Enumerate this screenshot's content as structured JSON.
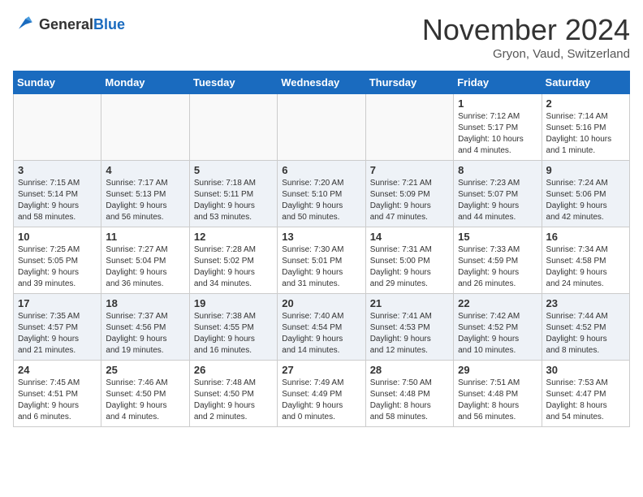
{
  "logo": {
    "general": "General",
    "blue": "Blue"
  },
  "header": {
    "month": "November 2024",
    "location": "Gryon, Vaud, Switzerland"
  },
  "weekdays": [
    "Sunday",
    "Monday",
    "Tuesday",
    "Wednesday",
    "Thursday",
    "Friday",
    "Saturday"
  ],
  "weeks": [
    [
      {
        "day": "",
        "info": ""
      },
      {
        "day": "",
        "info": ""
      },
      {
        "day": "",
        "info": ""
      },
      {
        "day": "",
        "info": ""
      },
      {
        "day": "",
        "info": ""
      },
      {
        "day": "1",
        "info": "Sunrise: 7:12 AM\nSunset: 5:17 PM\nDaylight: 10 hours\nand 4 minutes."
      },
      {
        "day": "2",
        "info": "Sunrise: 7:14 AM\nSunset: 5:16 PM\nDaylight: 10 hours\nand 1 minute."
      }
    ],
    [
      {
        "day": "3",
        "info": "Sunrise: 7:15 AM\nSunset: 5:14 PM\nDaylight: 9 hours\nand 58 minutes."
      },
      {
        "day": "4",
        "info": "Sunrise: 7:17 AM\nSunset: 5:13 PM\nDaylight: 9 hours\nand 56 minutes."
      },
      {
        "day": "5",
        "info": "Sunrise: 7:18 AM\nSunset: 5:11 PM\nDaylight: 9 hours\nand 53 minutes."
      },
      {
        "day": "6",
        "info": "Sunrise: 7:20 AM\nSunset: 5:10 PM\nDaylight: 9 hours\nand 50 minutes."
      },
      {
        "day": "7",
        "info": "Sunrise: 7:21 AM\nSunset: 5:09 PM\nDaylight: 9 hours\nand 47 minutes."
      },
      {
        "day": "8",
        "info": "Sunrise: 7:23 AM\nSunset: 5:07 PM\nDaylight: 9 hours\nand 44 minutes."
      },
      {
        "day": "9",
        "info": "Sunrise: 7:24 AM\nSunset: 5:06 PM\nDaylight: 9 hours\nand 42 minutes."
      }
    ],
    [
      {
        "day": "10",
        "info": "Sunrise: 7:25 AM\nSunset: 5:05 PM\nDaylight: 9 hours\nand 39 minutes."
      },
      {
        "day": "11",
        "info": "Sunrise: 7:27 AM\nSunset: 5:04 PM\nDaylight: 9 hours\nand 36 minutes."
      },
      {
        "day": "12",
        "info": "Sunrise: 7:28 AM\nSunset: 5:02 PM\nDaylight: 9 hours\nand 34 minutes."
      },
      {
        "day": "13",
        "info": "Sunrise: 7:30 AM\nSunset: 5:01 PM\nDaylight: 9 hours\nand 31 minutes."
      },
      {
        "day": "14",
        "info": "Sunrise: 7:31 AM\nSunset: 5:00 PM\nDaylight: 9 hours\nand 29 minutes."
      },
      {
        "day": "15",
        "info": "Sunrise: 7:33 AM\nSunset: 4:59 PM\nDaylight: 9 hours\nand 26 minutes."
      },
      {
        "day": "16",
        "info": "Sunrise: 7:34 AM\nSunset: 4:58 PM\nDaylight: 9 hours\nand 24 minutes."
      }
    ],
    [
      {
        "day": "17",
        "info": "Sunrise: 7:35 AM\nSunset: 4:57 PM\nDaylight: 9 hours\nand 21 minutes."
      },
      {
        "day": "18",
        "info": "Sunrise: 7:37 AM\nSunset: 4:56 PM\nDaylight: 9 hours\nand 19 minutes."
      },
      {
        "day": "19",
        "info": "Sunrise: 7:38 AM\nSunset: 4:55 PM\nDaylight: 9 hours\nand 16 minutes."
      },
      {
        "day": "20",
        "info": "Sunrise: 7:40 AM\nSunset: 4:54 PM\nDaylight: 9 hours\nand 14 minutes."
      },
      {
        "day": "21",
        "info": "Sunrise: 7:41 AM\nSunset: 4:53 PM\nDaylight: 9 hours\nand 12 minutes."
      },
      {
        "day": "22",
        "info": "Sunrise: 7:42 AM\nSunset: 4:52 PM\nDaylight: 9 hours\nand 10 minutes."
      },
      {
        "day": "23",
        "info": "Sunrise: 7:44 AM\nSunset: 4:52 PM\nDaylight: 9 hours\nand 8 minutes."
      }
    ],
    [
      {
        "day": "24",
        "info": "Sunrise: 7:45 AM\nSunset: 4:51 PM\nDaylight: 9 hours\nand 6 minutes."
      },
      {
        "day": "25",
        "info": "Sunrise: 7:46 AM\nSunset: 4:50 PM\nDaylight: 9 hours\nand 4 minutes."
      },
      {
        "day": "26",
        "info": "Sunrise: 7:48 AM\nSunset: 4:50 PM\nDaylight: 9 hours\nand 2 minutes."
      },
      {
        "day": "27",
        "info": "Sunrise: 7:49 AM\nSunset: 4:49 PM\nDaylight: 9 hours\nand 0 minutes."
      },
      {
        "day": "28",
        "info": "Sunrise: 7:50 AM\nSunset: 4:48 PM\nDaylight: 8 hours\nand 58 minutes."
      },
      {
        "day": "29",
        "info": "Sunrise: 7:51 AM\nSunset: 4:48 PM\nDaylight: 8 hours\nand 56 minutes."
      },
      {
        "day": "30",
        "info": "Sunrise: 7:53 AM\nSunset: 4:47 PM\nDaylight: 8 hours\nand 54 minutes."
      }
    ]
  ]
}
